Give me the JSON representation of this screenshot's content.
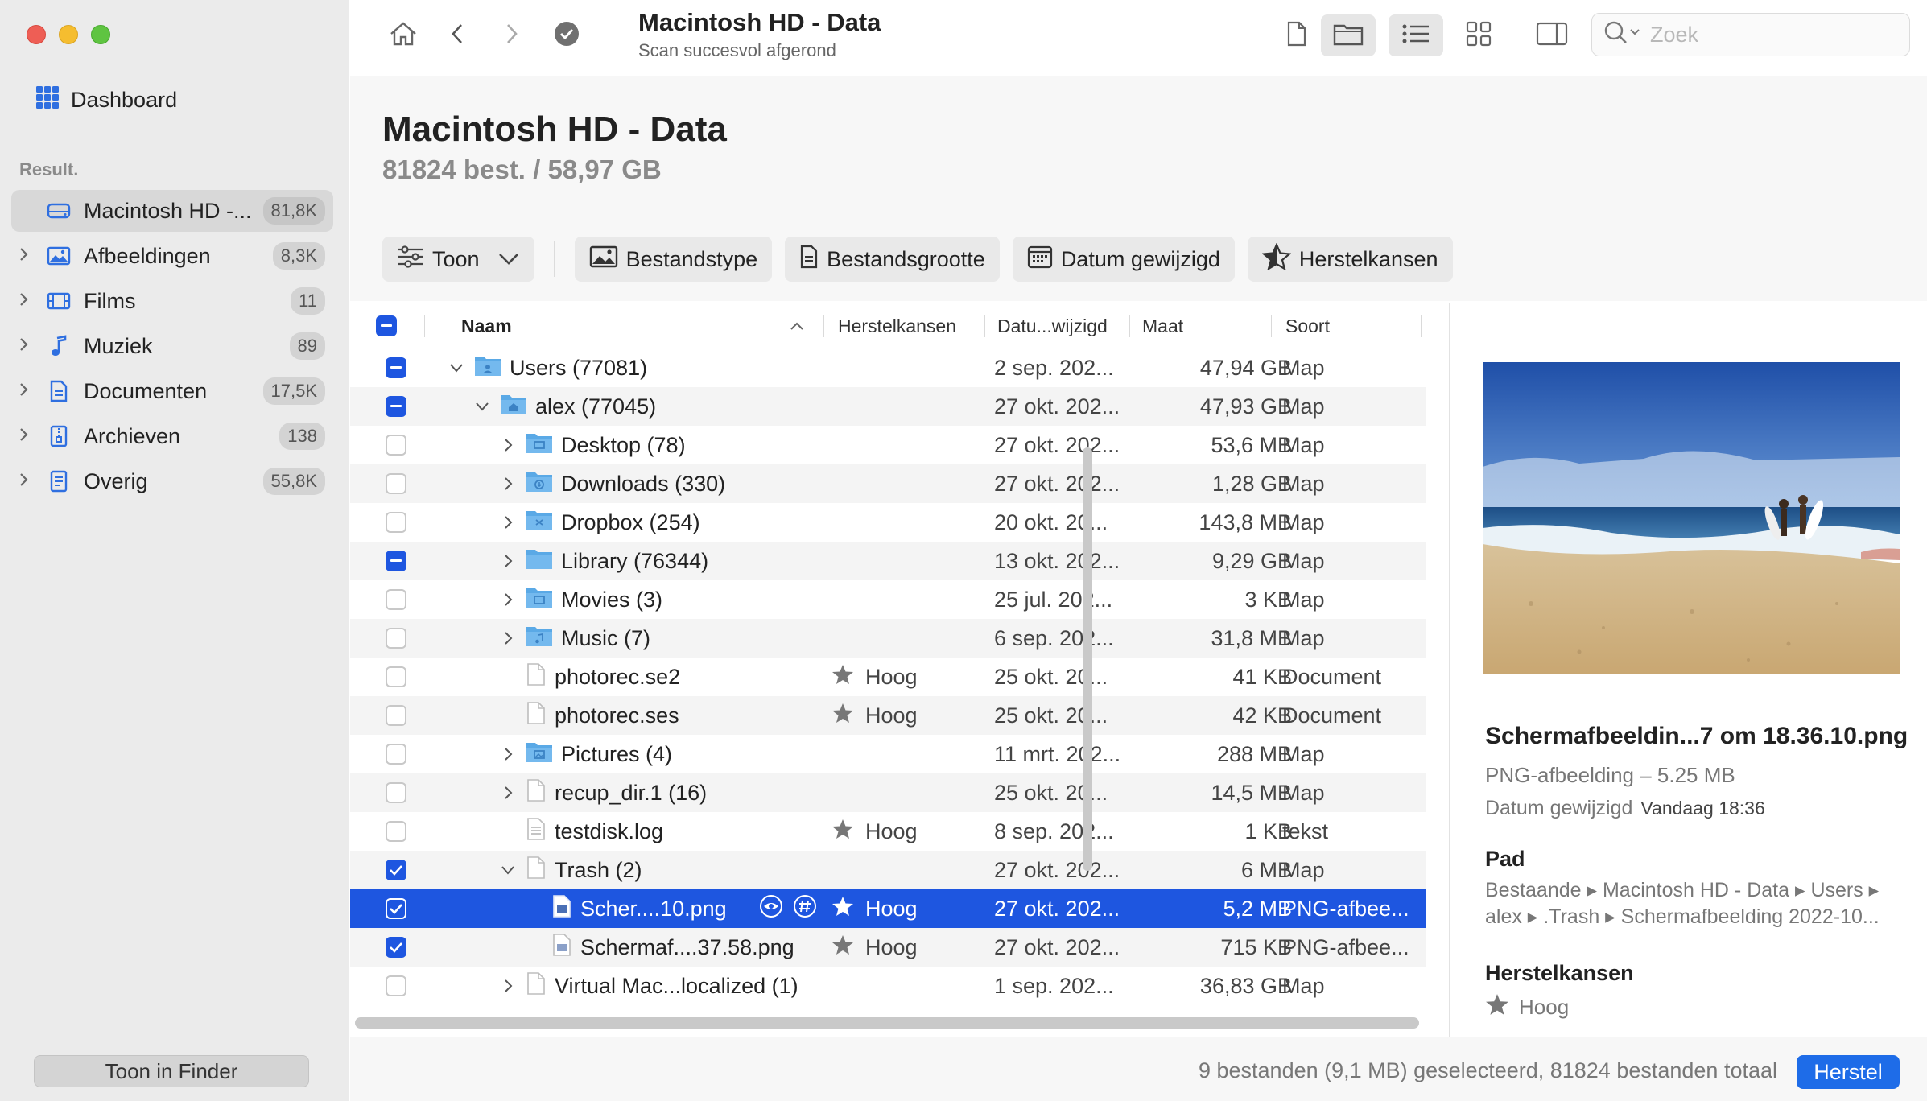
{
  "sidebar": {
    "dashboard_label": "Dashboard",
    "section_heading": "Result.",
    "items": [
      {
        "label": "Macintosh HD -...",
        "count": "81,8K",
        "icon": "drive-icon"
      },
      {
        "label": "Afbeeldingen",
        "count": "8,3K",
        "icon": "image-icon"
      },
      {
        "label": "Films",
        "count": "11",
        "icon": "film-icon"
      },
      {
        "label": "Muziek",
        "count": "89",
        "icon": "music-icon"
      },
      {
        "label": "Documenten",
        "count": "17,5K",
        "icon": "document-icon"
      },
      {
        "label": "Archieven",
        "count": "138",
        "icon": "archive-icon"
      },
      {
        "label": "Overig",
        "count": "55,8K",
        "icon": "other-icon"
      }
    ],
    "finder_button": "Toon in Finder"
  },
  "toolbar": {
    "title": "Macintosh HD - Data",
    "subtitle": "Scan succesvol afgerond",
    "search_placeholder": "Zoek"
  },
  "header": {
    "title": "Macintosh HD - Data",
    "summary": "81824 best. / 58,97 GB"
  },
  "filters": {
    "toon": "Toon",
    "bestandstype": "Bestandstype",
    "bestandsgrootte": "Bestandsgrootte",
    "datum": "Datum gewijzigd",
    "herstelkansen": "Herstelkansen"
  },
  "table": {
    "columns": {
      "naam": "Naam",
      "herstelkansen": "Herstelkansen",
      "datum": "Datu...wijzigd",
      "maat": "Maat",
      "soort": "Soort"
    },
    "rows": [
      {
        "name": "Users (77081)",
        "date": "2 sep. 202...",
        "size": "47,94 GB",
        "kind": "Map",
        "rec": "",
        "check": "mixed"
      },
      {
        "name": "alex (77045)",
        "date": "27 okt. 202...",
        "size": "47,93 GB",
        "kind": "Map",
        "rec": "",
        "check": "mixed"
      },
      {
        "name": "Desktop (78)",
        "date": "27 okt. 202...",
        "size": "53,6 MB",
        "kind": "Map",
        "rec": "",
        "check": "off"
      },
      {
        "name": "Downloads (330)",
        "date": "27 okt. 202...",
        "size": "1,28 GB",
        "kind": "Map",
        "rec": "",
        "check": "off"
      },
      {
        "name": "Dropbox (254)",
        "date": "20 okt. 20...",
        "size": "143,8 MB",
        "kind": "Map",
        "rec": "",
        "check": "off"
      },
      {
        "name": "Library (76344)",
        "date": "13 okt. 202...",
        "size": "9,29 GB",
        "kind": "Map",
        "rec": "",
        "check": "mixed"
      },
      {
        "name": "Movies (3)",
        "date": "25 jul. 202...",
        "size": "3 KB",
        "kind": "Map",
        "rec": "",
        "check": "off"
      },
      {
        "name": "Music (7)",
        "date": "6 sep. 202...",
        "size": "31,8 MB",
        "kind": "Map",
        "rec": "",
        "check": "off"
      },
      {
        "name": "photorec.se2",
        "date": "25 okt. 20...",
        "size": "41 KB",
        "kind": "Document",
        "rec": "Hoog",
        "check": "off"
      },
      {
        "name": "photorec.ses",
        "date": "25 okt. 20...",
        "size": "42 KB",
        "kind": "Document",
        "rec": "Hoog",
        "check": "off"
      },
      {
        "name": "Pictures (4)",
        "date": "11 mrt. 202...",
        "size": "288 MB",
        "kind": "Map",
        "rec": "",
        "check": "off"
      },
      {
        "name": "recup_dir.1 (16)",
        "date": "25 okt. 20...",
        "size": "14,5 MB",
        "kind": "Map",
        "rec": "",
        "check": "off"
      },
      {
        "name": "testdisk.log",
        "date": "8 sep. 202...",
        "size": "1 KB",
        "kind": "tekst",
        "rec": "Hoog",
        "check": "off"
      },
      {
        "name": "Trash (2)",
        "date": "27 okt. 202...",
        "size": "6 MB",
        "kind": "Map",
        "rec": "",
        "check": "on"
      },
      {
        "name": "Scher....10.png",
        "date": "27 okt. 202...",
        "size": "5,2 MB",
        "kind": "PNG-afbee...",
        "rec": "Hoog",
        "check": "on"
      },
      {
        "name": "Schermaf....37.58.png",
        "date": "27 okt. 202...",
        "size": "715 KB",
        "kind": "PNG-afbee...",
        "rec": "Hoog",
        "check": "on"
      },
      {
        "name": "Virtual Mac...localized (1)",
        "date": "1 sep. 202...",
        "size": "36,83 GB",
        "kind": "Map",
        "rec": "",
        "check": "off"
      }
    ]
  },
  "inspector": {
    "file_name": "Schermafbeeldin...7 om 18.36.10.png",
    "file_type": "PNG-afbeelding – 5.25 MB",
    "modified_label": "Datum gewijzigd",
    "modified_value": "Vandaag 18:36",
    "path_heading": "Pad",
    "path_text": "Bestaande ▸ Macintosh HD - Data ▸ Users ▸ alex ▸ .Trash ▸ Schermafbeelding 2022-10...",
    "recovery_heading": "Herstelkansen",
    "recovery_value": "Hoog"
  },
  "footer": {
    "status": "9 bestanden (9,1 MB) geselecteerd, 81824 bestanden totaal",
    "restore_button": "Herstel"
  },
  "colors": {
    "accent": "#1e56e0",
    "button": "#1e6ce8",
    "folder": "#5aa9e6"
  }
}
